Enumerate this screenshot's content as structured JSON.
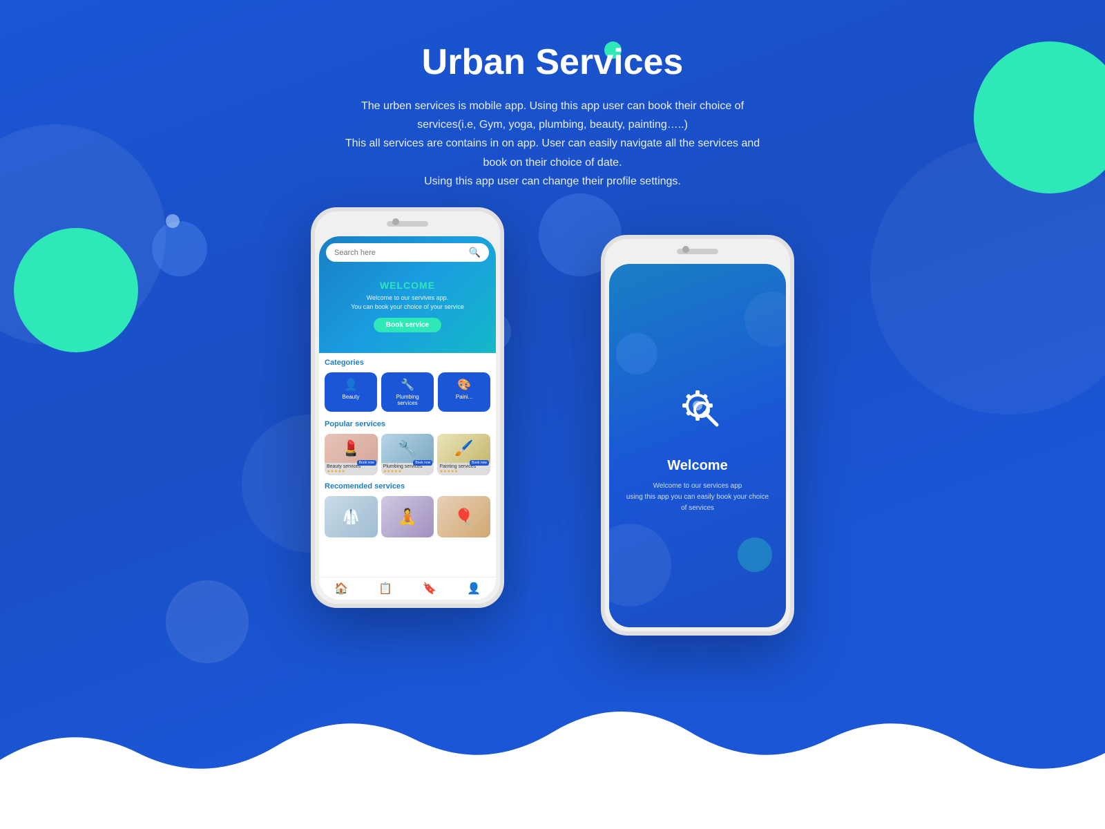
{
  "page": {
    "title": "Urban Services",
    "description_lines": [
      "The urben services is mobile app. Using this app user can book their choice of",
      "services(i.e, Gym, yoga, plumbing, beauty, painting…..)",
      "This all services are contains in on app. User can easily navigate all the services",
      "and book on their choice of date.",
      "Using this app user can change their profile settings."
    ],
    "description": "The urben services is mobile app. Using this app user can book their choice of services(i.e, Gym, yoga, plumbing, beauty, painting…..)\nThis all services are contains in on app. User can easily navigate all the services and book on their choice of date.\nUsing this app user can change their profile settings."
  },
  "left_phone": {
    "search_placeholder": "Search here",
    "welcome_title": "WELCOME",
    "welcome_subtitle": "Welcome to our servives app.\nYou can book your choice of your service",
    "book_button": "Book service",
    "categories_title": "Categories",
    "categories": [
      {
        "label": "Beauty",
        "icon": "👤"
      },
      {
        "label": "Plumbing services",
        "icon": "🔧"
      },
      {
        "label": "Paini...",
        "icon": "🎨"
      }
    ],
    "popular_title": "Popular services",
    "popular_services": [
      {
        "label": "Beauty services",
        "stars": "★★★★★"
      },
      {
        "label": "Plumbing services",
        "stars": "★★★★★"
      },
      {
        "label": "Painting services",
        "stars": "★★★★★"
      }
    ],
    "recommended_title": "Recomended services",
    "recommended_services": [
      {
        "label": "Doctor",
        "type": "doctor"
      },
      {
        "label": "Yoga",
        "type": "yoga"
      },
      {
        "label": "Balloon",
        "type": "balloon"
      }
    ]
  },
  "right_phone": {
    "icon": "⚙️",
    "title": "Welcome",
    "description": "Welcome to our services app\nusing this app you can easily book your choice\nof services"
  },
  "colors": {
    "primary_blue": "#1a56d6",
    "teal": "#2ee8b8",
    "white": "#ffffff",
    "bg_gradient_start": "#1a56d6",
    "bg_gradient_end": "#1a4fc4"
  }
}
